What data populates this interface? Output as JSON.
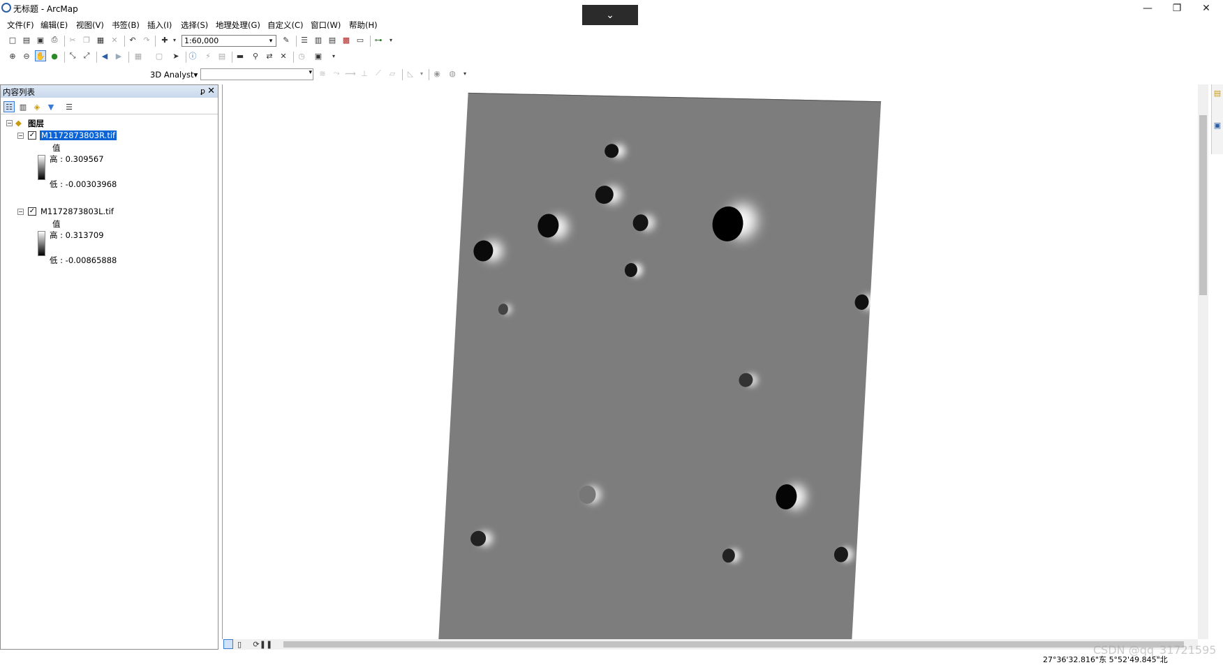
{
  "window": {
    "title": "无标题 - ArcMap",
    "minimize": "—",
    "restore": "❐",
    "close": "✕",
    "ribbon_toggle": "⌄"
  },
  "menu": [
    "文件(F)",
    "编辑(E)",
    "视图(V)",
    "书签(B)",
    "插入(I)",
    "选择(S)",
    "地理处理(G)",
    "自定义(C)",
    "窗口(W)",
    "帮助(H)"
  ],
  "toolbar": {
    "scale": "1:60,000",
    "analyst_label": "3D Analyst▾"
  },
  "toc": {
    "title": "内容列表",
    "pin": "ꝑ",
    "close": "✕",
    "group": "图层",
    "layers": [
      {
        "name": "M1172873803R.tif",
        "value_label": "值",
        "high": "高 : 0.309567",
        "low": "低 : -0.00303968",
        "checked": "✓",
        "expander": "−"
      },
      {
        "name": "M1172873803L.tif",
        "value_label": "值",
        "high": "高 : 0.313709",
        "low": "低 : -0.00865888",
        "checked": "✓",
        "expander": "−"
      }
    ]
  },
  "status": {
    "coords": "27°36'32.816\"东  5°52'49.845\"北"
  },
  "watermark": "CSDN @qq_31721595",
  "icons": [
    "zoom-in-icon",
    "zoom-out-icon",
    "pan-icon",
    "globe-icon",
    "full-extent-icon",
    "back-icon",
    "forward-icon",
    "select-icon",
    "identify-icon",
    "find-icon",
    "measure-icon",
    "new-icon",
    "open-icon",
    "save-icon",
    "print-icon",
    "undo-icon",
    "redo-icon",
    "add-data-icon"
  ]
}
